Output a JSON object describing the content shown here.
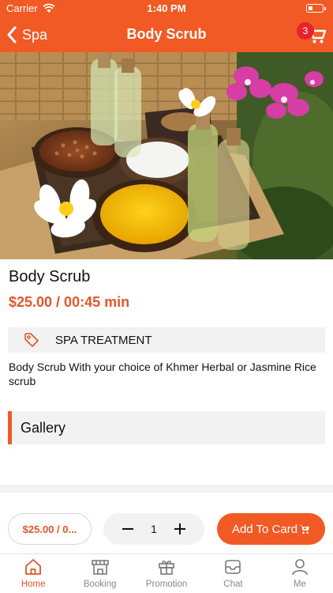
{
  "status_bar": {
    "carrier": "Carrier",
    "time": "1:40 PM"
  },
  "nav": {
    "back_label": "Spa",
    "title": "Body Scrub",
    "cart_count": "3",
    "back_icon": "chevron-left-icon",
    "cart_icon": "cart-icon"
  },
  "hero_image": {
    "subject": "spa scrub bowls, oil bottles, frangipani and orchid flowers"
  },
  "product": {
    "name": "Body Scrub",
    "price": "$25.00 / 00:45 min",
    "category": "SPA TREATMENT",
    "category_icon": "tag-icon",
    "description": "Body Scrub With your choice of Khmer Herbal or Jasmine Rice scrub"
  },
  "gallery": {
    "title": "Gallery"
  },
  "action_bar": {
    "price_short": "$25.00 / 0...",
    "quantity": "1",
    "add_label": "Add To Card"
  },
  "tabs": [
    {
      "label": "Home",
      "icon": "home-icon",
      "active": true
    },
    {
      "label": "Booking",
      "icon": "booking-icon",
      "active": false
    },
    {
      "label": "Promotion",
      "icon": "gift-icon",
      "active": false
    },
    {
      "label": "Chat",
      "icon": "inbox-icon",
      "active": false
    },
    {
      "label": "Me",
      "icon": "user-icon",
      "active": false
    }
  ],
  "colors": {
    "accent": "#f15a24",
    "price": "#e3552a",
    "badge": "#e8222a",
    "panel": "#f2f2f2",
    "tab_inactive": "#888888"
  }
}
